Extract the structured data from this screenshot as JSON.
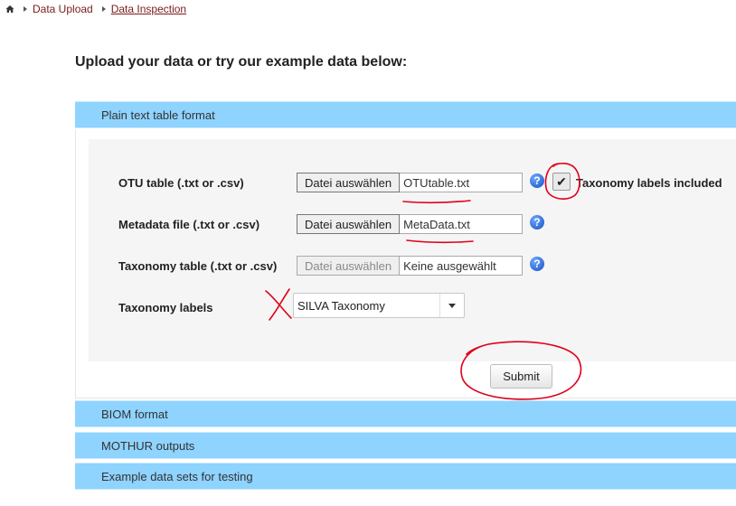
{
  "breadcrumb": {
    "items": [
      "Data Upload",
      "Data Inspection"
    ]
  },
  "heading": "Upload your data or try our example data below:",
  "accordion": [
    "Plain text table format",
    "BIOM format",
    "MOTHUR outputs",
    "Example data sets for testing"
  ],
  "form": {
    "otu": {
      "label": "OTU table (.txt or .csv)",
      "button": "Datei auswählen",
      "file": "OTUtable.txt"
    },
    "meta": {
      "label": "Metadata file (.txt or .csv)",
      "button": "Datei auswählen",
      "file": "MetaData.txt"
    },
    "tax": {
      "label": "Taxonomy table (.txt or .csv)",
      "button": "Datei auswählen",
      "file": "Keine ausgewählt"
    },
    "taxonomy_labels": {
      "label": "Taxonomy labels",
      "selected": "SILVA Taxonomy"
    },
    "checkbox_label": "Taxonomy labels included",
    "help_glyph": "?",
    "check_glyph": "✔",
    "submit": "Submit"
  },
  "colors": {
    "accordion": "#8fd3ff",
    "annotation": "#e0001a"
  }
}
